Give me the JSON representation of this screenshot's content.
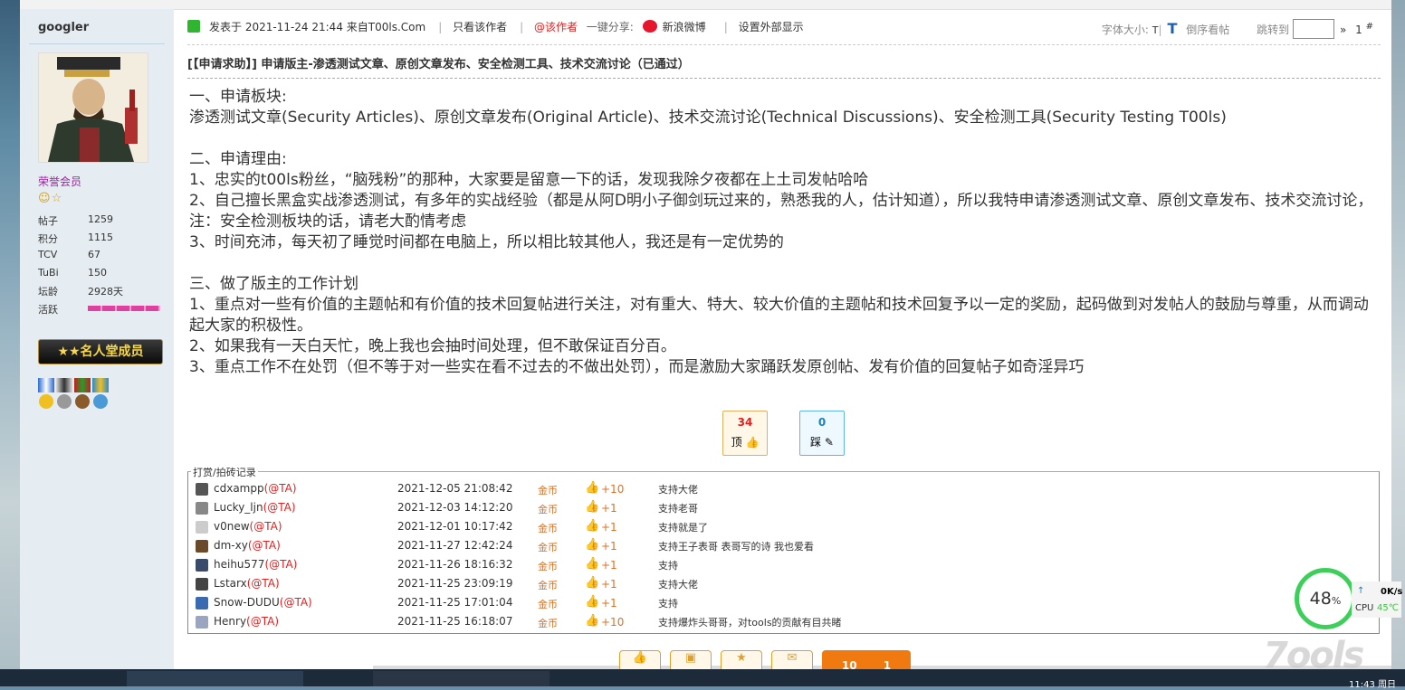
{
  "user": {
    "name": "googler",
    "group": "荣誉会员",
    "stats": [
      {
        "k": "帖子",
        "v": "1259"
      },
      {
        "k": "积分",
        "v": "1115"
      },
      {
        "k": "TCV",
        "v": "67"
      },
      {
        "k": "TuBi",
        "v": "150"
      },
      {
        "k": "坛龄",
        "v": "2928天"
      },
      {
        "k": "活跃",
        "v": ""
      }
    ],
    "fame_badge": "名人堂成员"
  },
  "post_header": {
    "posted": "发表于 2021-11-24 21:44 来自T00ls.Com",
    "only_author": "只看该作者",
    "at_author": "@该作者",
    "share": "一键分享:",
    "weibo": "新浪微博",
    "external": "设置外部显示",
    "font_size": "字体大小:",
    "font_small": "T",
    "font_big": "T",
    "reverse": "倒序看帖",
    "jump": "跳转到",
    "floor": "1",
    "hash": "#",
    "arrow": "»"
  },
  "title": "[【申请求助】] 申请版主-渗透测试文章、原创文章发布、安全检测工具、技术交流讨论（已通过）",
  "content": {
    "s1_title": "一、申请板块:",
    "s1_body": "渗透测试文章(Security Articles)、原创文章发布(Original Article)、技术交流讨论(Technical Discussions)、安全检测工具(Security Testing T00ls)",
    "s2_title": "二、申请理由:",
    "s2_l1": "1、忠实的t00ls粉丝，“脑残粉”的那种，大家要是留意一下的话，发现我除夕夜都在上土司发帖哈哈",
    "s2_l2": "2、自己擅长黑盒实战渗透测试，有多年的实战经验（都是从阿D明小子御剑玩过来的，熟悉我的人，估计知道），所以我特申请渗透测试文章、原创文章发布、技术交流讨论，注：安全检测板块的话，请老大酌情考虑",
    "s2_l3": "3、时间充沛，每天初了睡觉时间都在电脑上，所以相比较其他人，我还是有一定优势的",
    "s3_title": "三、做了版主的工作计划",
    "s3_l1": "1、重点对一些有价值的主题帖和有价值的技术回复帖进行关注，对有重大、特大、较大价值的主题帖和技术回复予以一定的奖励，起码做到对发帖人的鼓励与尊重，从而调动起大家的积极性。",
    "s3_l2": "2、如果我有一天白天忙，晚上我也会抽时间处理，但不敢保证百分百。",
    "s3_l3": "3、重点工作不在处罚（但不等于对一些实在看不过去的不做出处罚），而是激励大家踊跃发原创帖、发有价值的回复帖子如奇淫异巧"
  },
  "votes": {
    "up_count": "34",
    "up_label": "顶",
    "down_count": "0",
    "down_label": "踩"
  },
  "reward_log": {
    "title": "打赏/拍砖记录",
    "ta": "(@TA)",
    "coin": "金币",
    "rows": [
      {
        "name": "cdxampp",
        "time": "2021-12-05 21:08:42",
        "amount": "+10",
        "msg": "支持大佬",
        "color": "#555"
      },
      {
        "name": "Lucky_ljn",
        "time": "2021-12-03 14:12:20",
        "amount": "+1",
        "msg": "支持老哥",
        "color": "#888"
      },
      {
        "name": "v0new",
        "time": "2021-12-01 10:17:42",
        "amount": "+1",
        "msg": "支持就是了",
        "color": "#ccc"
      },
      {
        "name": "dm-xy",
        "time": "2021-11-27 12:42:24",
        "amount": "+1",
        "msg": "支持王子表哥 表哥写的诗 我也爱看",
        "color": "#6b4a2a"
      },
      {
        "name": "heihu577",
        "time": "2021-11-26 18:16:32",
        "amount": "+1",
        "msg": "支持",
        "color": "#3a4a6a"
      },
      {
        "name": "Lstarx",
        "time": "2021-11-25 23:09:19",
        "amount": "+1",
        "msg": "支持大佬",
        "color": "#444"
      },
      {
        "name": "Snow-DUDU",
        "time": "2021-11-25 17:01:04",
        "amount": "+1",
        "msg": "支持",
        "color": "#3a6ab0"
      },
      {
        "name": "Henry",
        "time": "2021-11-25 16:18:07",
        "amount": "+10",
        "msg": "支持爆炸头哥哥，对tools的贡献有目共睹",
        "color": "#9aa6c0"
      }
    ]
  },
  "bottom": {
    "big_left": "10",
    "big_right": "1"
  },
  "cpu": {
    "percent": "48",
    "pct_sign": "%",
    "net": "0K/s",
    "label": "CPU",
    "temp": "45℃",
    "arrow": "↑"
  },
  "watermark": "7ools",
  "clock": "11:43 周日",
  "colors": {
    "accent": "#1a5fb4",
    "red": "#e02020",
    "coin": "#e07020",
    "sidebar": "#e5edf2"
  }
}
